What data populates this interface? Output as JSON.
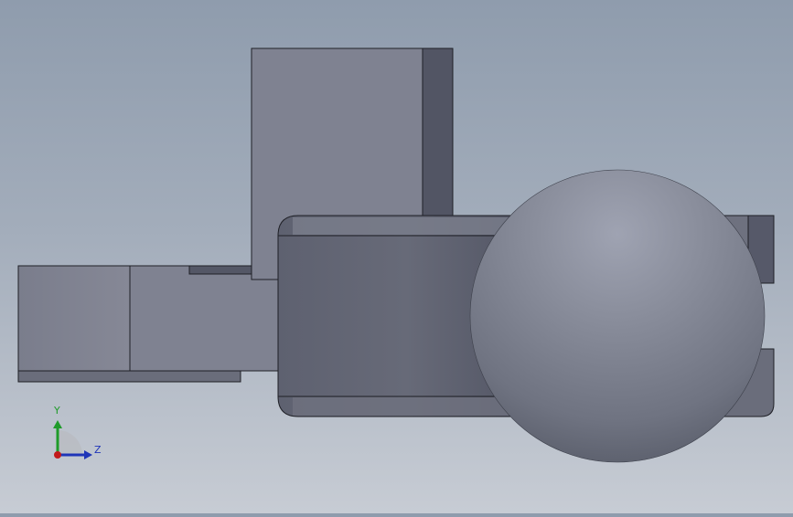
{
  "view": {
    "background_top": "#8f9cad",
    "background_bottom": "#c7ccd4",
    "model_face_color": "#7f8291",
    "model_shadow_color": "#5f6270",
    "edge_color": "#1f2026",
    "sphere_color": "#7b7f8d"
  },
  "triad": {
    "y_label": "Y",
    "z_label": "Z",
    "y_color": "#1f9b2a",
    "z_color": "#1f35b8",
    "x_color": "#c21a1a"
  }
}
